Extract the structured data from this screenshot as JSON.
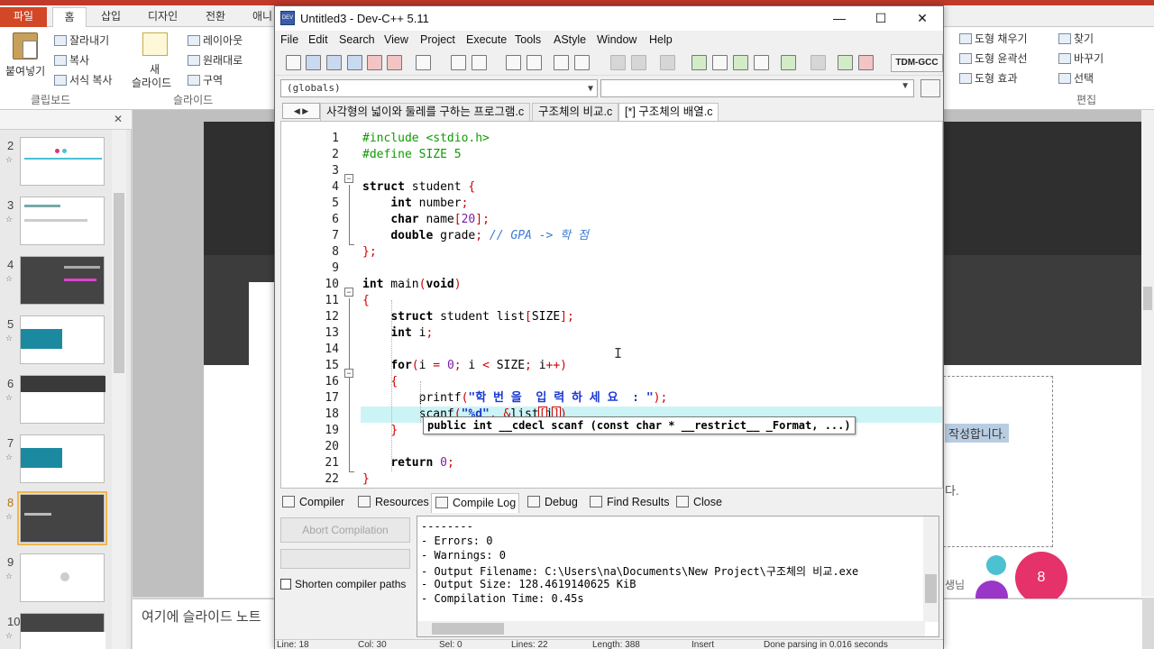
{
  "ppt": {
    "tabs": [
      "파일",
      "홈",
      "삽입",
      "디자인",
      "전환",
      "애니"
    ],
    "ribbon": {
      "paste": "붙여넣기",
      "cut": "잘라내기",
      "copy": "복사",
      "format_painter": "서식 복사",
      "clipboard_group": "클립보드",
      "new_slide_line1": "새",
      "new_slide_line2": "슬라이드",
      "layout": "레이아웃",
      "reset": "원래대로",
      "section": "구역",
      "slides_group": "슬라이드",
      "shape_fill": "도형 채우기",
      "shape_outline": "도형 윤곽선",
      "shape_effects": "도형 효과",
      "find": "찾기",
      "replace": "바꾸기",
      "select": "선택",
      "editing_group": "편집"
    },
    "slide_numbers": [
      "2",
      "3",
      "4",
      "5",
      "6",
      "7",
      "8",
      "9",
      "10"
    ],
    "slide_star": "☆",
    "slide_text_selected": "작성합니다.",
    "slide_text2": "다.",
    "slide_text3": "생님",
    "circle_number": "8",
    "notes_placeholder": "여기에 슬라이드 노트"
  },
  "devcpp": {
    "title": "Untitled3 - Dev-C++ 5.11",
    "icon_label": "DEV",
    "window_buttons": {
      "minimize": "—",
      "maximize": "☐",
      "close": "✕"
    },
    "menu": [
      "File",
      "Edit",
      "Search",
      "View",
      "Project",
      "Execute",
      "Tools",
      "AStyle",
      "Window",
      "Help"
    ],
    "compiler": "TDM-GCC",
    "scope": "(globals)",
    "tab_nav": "◀ ▶",
    "file_tabs": [
      "사각형의 넓이와 둘레를 구하는 프로그램.c",
      "구조체의 비교.c",
      "[*] 구조체의 배열.c"
    ],
    "active_file_tab": 2,
    "code_lines": [
      {
        "n": "1",
        "html": "<span class=\"pp\">#include &lt;stdio.h&gt;</span>"
      },
      {
        "n": "2",
        "html": "<span class=\"pp\">#define SIZE 5</span>"
      },
      {
        "n": "3",
        "html": ""
      },
      {
        "n": "4",
        "html": "<span class=\"kw\">struct</span> student <span class=\"sym\">{</span>"
      },
      {
        "n": "5",
        "html": "    <span class=\"kw\">int</span> number<span class=\"sym\">;</span>"
      },
      {
        "n": "6",
        "html": "    <span class=\"kw\">char</span> name<span class=\"sym\">[</span><span class=\"num\">20</span><span class=\"sym\">];</span>"
      },
      {
        "n": "7",
        "html": "    <span class=\"kw\">double</span> grade<span class=\"sym\">;</span> <span class=\"cm\">// GPA -&gt; 학 점</span>"
      },
      {
        "n": "8",
        "html": "<span class=\"sym\">};</span>"
      },
      {
        "n": "9",
        "html": ""
      },
      {
        "n": "10",
        "html": "<span class=\"kw\">int</span> main<span class=\"sym\">(</span><span class=\"kw\">void</span><span class=\"sym\">)</span>"
      },
      {
        "n": "11",
        "html": "<span class=\"sym\">{</span>"
      },
      {
        "n": "12",
        "html": "    <span class=\"kw\">struct</span> student list<span class=\"sym\">[</span>SIZE<span class=\"sym\">];</span>"
      },
      {
        "n": "13",
        "html": "    <span class=\"kw\">int</span> i<span class=\"sym\">;</span>"
      },
      {
        "n": "14",
        "html": ""
      },
      {
        "n": "15",
        "html": "    <span class=\"kw\">for</span><span class=\"sym\">(</span>i <span class=\"sym\">=</span> <span class=\"num\">0</span><span class=\"sym\">;</span> i <span class=\"sym\">&lt;</span> SIZE<span class=\"sym\">;</span> i<span class=\"sym\">++)</span>"
      },
      {
        "n": "16",
        "html": "    <span class=\"sym\">{</span>"
      },
      {
        "n": "17",
        "html": "        printf<span class=\"sym\">(</span><span class=\"str-b\">\"학 번 을  입 력 하 세 요  : \"</span><span class=\"sym\">);</span>"
      },
      {
        "n": "18",
        "html": "        scanf<span class=\"sym\">(</span><span class=\"str-b\">\"%d\"</span><span class=\"sym\">,</span> <span class=\"sym\">&amp;</span>list<span class=\"brk\">[</span>i<span class=\"brk\">]</span><span class=\"sym\">)</span>"
      },
      {
        "n": "19",
        "html": "    <span class=\"sym\">}</span>"
      },
      {
        "n": "20",
        "html": ""
      },
      {
        "n": "21",
        "html": "    <span class=\"kw\">return</span> <span class=\"num\">0</span><span class=\"sym\">;</span>"
      },
      {
        "n": "22",
        "html": "<span class=\"sym\">}</span>"
      }
    ],
    "highlighted_line": 18,
    "calltip": "public int __cdecl scanf (const char * __restrict__ _Format, ...)",
    "bottom_tabs": [
      "Compiler",
      "Resources",
      "Compile Log",
      "Debug",
      "Find Results",
      "Close"
    ],
    "active_bottom_tab": 2,
    "abort_label": "Abort Compilation",
    "shorten_label": "Shorten compiler paths",
    "log_lines": [
      "--------",
      "- Errors: 0",
      "- Warnings: 0",
      "- Output Filename: C:\\Users\\na\\Documents\\New Project\\구조체의 비교.exe",
      "- Output Size: 128.4619140625 KiB",
      "- Compilation Time: 0.45s"
    ],
    "status_items": [
      "Line: 18",
      "Col: 30",
      "Sel: 0",
      "Lines: 22",
      "Length: 388",
      "Insert",
      "Done parsing in 0.016 seconds"
    ]
  },
  "colors": {
    "ppt_file_tab": "#d24726",
    "current_line": "#ccf4f6",
    "preprocessor": "#0e9c00",
    "string": "#1a38d4",
    "symbol": "#d00000",
    "comment": "#3b7cd1"
  }
}
